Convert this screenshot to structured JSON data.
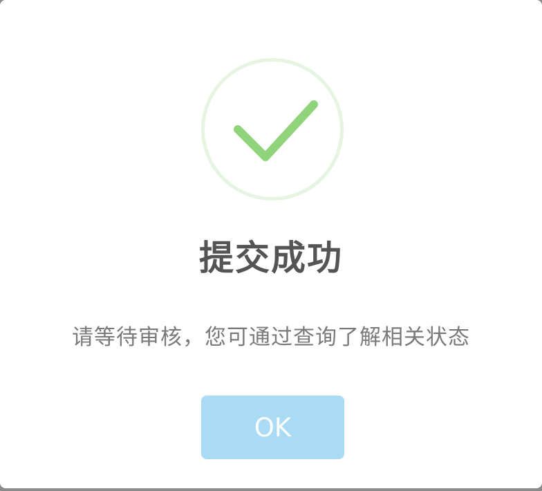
{
  "dialog": {
    "title": "提交成功",
    "message": "请等待审核，您可通过查询了解相关状态",
    "ok_label": "OK",
    "icon": "success-checkmark-icon"
  },
  "colors": {
    "check": "#8fd37a",
    "ring": "#e6f4e2",
    "title": "#545454",
    "message": "#7a7a7a",
    "button_bg": "#a9dbf4",
    "button_text": "#ffffff",
    "overlay": "#8c8c8c"
  }
}
